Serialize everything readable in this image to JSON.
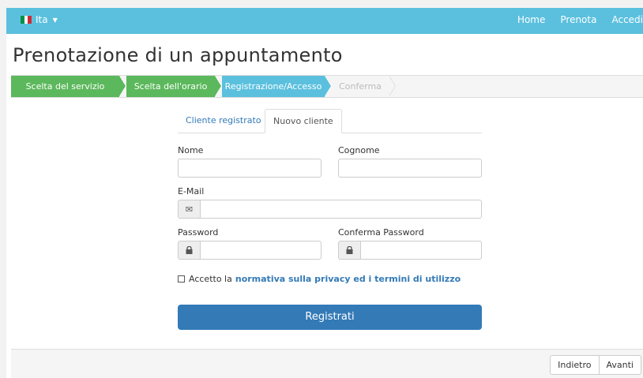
{
  "navbar": {
    "language_label": "Ita",
    "language_flag_colors": [
      "#009246",
      "#ffffff",
      "#ce2b37"
    ],
    "links": [
      "Home",
      "Prenota",
      "Accedi"
    ]
  },
  "page_title": "Prenotazione di un appuntamento",
  "steps": [
    {
      "label": "Scelta del servizio",
      "state": "done"
    },
    {
      "label": "Scelta dell'orario",
      "state": "done"
    },
    {
      "label": "Registrazione/Accesso",
      "state": "active"
    },
    {
      "label": "Conferma",
      "state": "todo"
    }
  ],
  "tabs": {
    "registered": "Cliente registrato",
    "new": "Nuovo cliente"
  },
  "form": {
    "nome_label": "Nome",
    "cognome_label": "Cognome",
    "email_label": "E-Mail",
    "password_label": "Password",
    "confirm_password_label": "Conferma Password",
    "email_icon": "envelope-icon",
    "password_icon": "lock-icon"
  },
  "privacy": {
    "prefix": "Accetto la",
    "link": "normativa sulla privacy ed i termini di utilizzo"
  },
  "register_button": "Registrati",
  "footer": {
    "back": "Indietro",
    "next": "Avanti"
  },
  "colors": {
    "navbar": "#5bc0de",
    "step_done": "#5cb85c",
    "step_active": "#5bc0de",
    "primary": "#337ab7"
  }
}
